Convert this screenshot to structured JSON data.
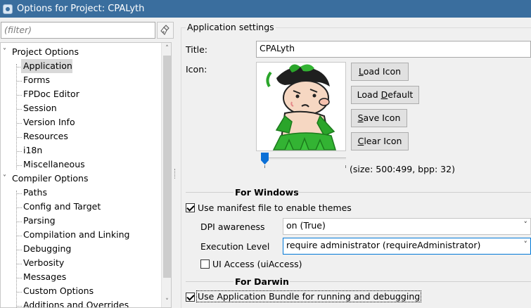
{
  "window": {
    "title": "Options for Project: CPALyth"
  },
  "filter": {
    "placeholder": "(filter)"
  },
  "tree": {
    "groups": [
      {
        "label": "Project Options",
        "expanded": true,
        "items": [
          "Application",
          "Forms",
          "FPDoc Editor",
          "Session",
          "Version Info",
          "Resources",
          "i18n",
          "Miscellaneous"
        ]
      },
      {
        "label": "Compiler Options",
        "expanded": true,
        "items": [
          "Paths",
          "Config and Target",
          "Parsing",
          "Compilation and Linking",
          "Debugging",
          "Verbosity",
          "Messages",
          "Custom Options",
          "Additions and Overrides"
        ]
      }
    ],
    "selected": "Application"
  },
  "app": {
    "group_title": "Application settings",
    "title_label": "Title:",
    "title_value": "CPALyth",
    "icon_label": "Icon:",
    "buttons": {
      "load_icon": {
        "pre": "",
        "ul": "L",
        "post": "oad Icon"
      },
      "load_default": {
        "pre": "Load ",
        "ul": "D",
        "post": "efault"
      },
      "save_icon": {
        "pre": "",
        "ul": "S",
        "post": "ave Icon"
      },
      "clear_icon": {
        "pre": "",
        "ul": "C",
        "post": "lear Icon"
      }
    },
    "icon_info": "(size: 500:499, bpp: 32)",
    "slider_value": 0
  },
  "windows": {
    "heading": "For Windows",
    "use_manifest": {
      "label": "Use manifest file to enable themes",
      "checked": true
    },
    "dpi": {
      "label": "DPI awareness",
      "value": "on (True)"
    },
    "exec": {
      "label": "Execution Level",
      "value": "require administrator (requireAdministrator)"
    },
    "ui_access": {
      "label": "UI Access (uiAccess)",
      "checked": false
    }
  },
  "darwin": {
    "heading": "For Darwin",
    "bundle": {
      "label": "Use Application Bundle for running and debugging",
      "checked": true
    }
  },
  "colors": {
    "titlebar": "#3a6e9e",
    "selection": "#d9d9d9",
    "focus_border": "#0078d7",
    "slider": "#0a6fd6"
  },
  "icons": {
    "title": "lazarus-options-icon",
    "filter_clear": "broom-icon",
    "expand": "chevron-down-icon",
    "scroll_up": "chevron-up-icon",
    "scroll_down": "chevron-down-icon"
  }
}
